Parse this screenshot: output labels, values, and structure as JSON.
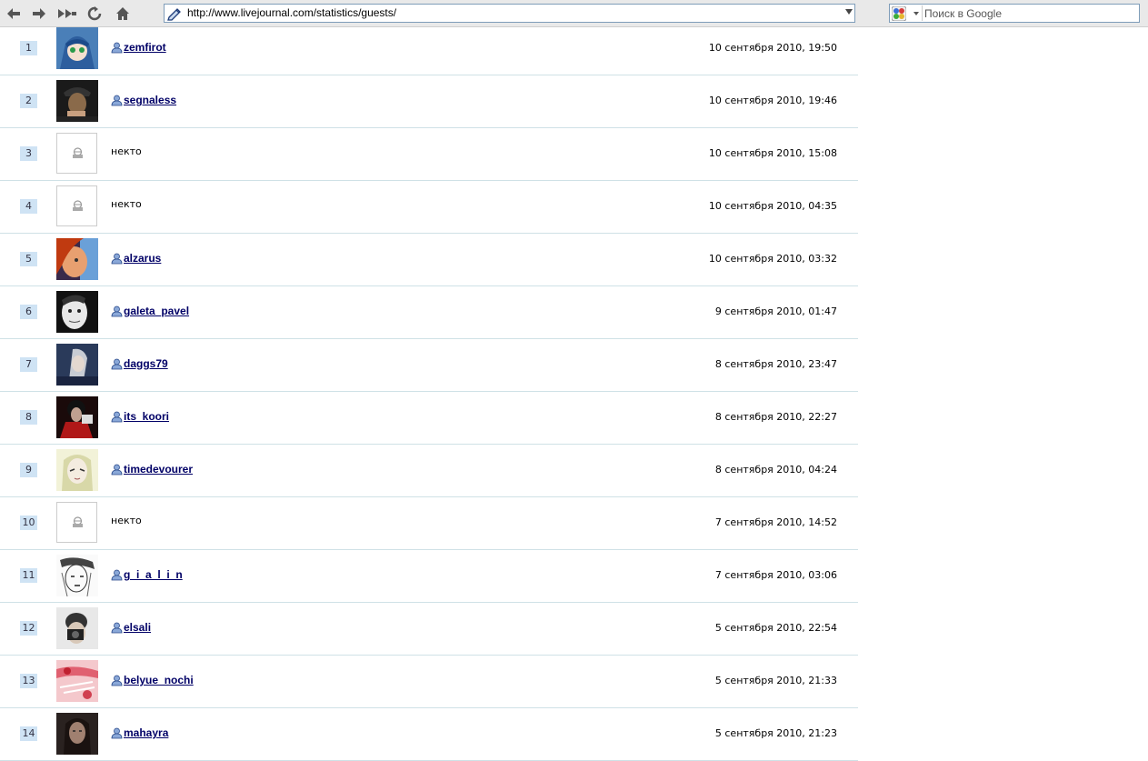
{
  "browser": {
    "url": "http://www.livejournal.com/statistics/guests/",
    "search_placeholder": "Поиск в Google",
    "nav_icons": [
      "back-icon",
      "forward-icon",
      "fast-forward-icon",
      "reload-icon",
      "home-icon"
    ]
  },
  "anon_label": "некто",
  "guests": [
    {
      "num": "1",
      "user": "zemfirot",
      "date": "10 сентября 2010, 19:50",
      "pic": "blue-anime"
    },
    {
      "num": "2",
      "user": "segnaless",
      "date": "10 сентября 2010, 19:46",
      "pic": "dark-portrait"
    },
    {
      "num": "3",
      "user": "",
      "date": "10 сентября 2010, 15:08",
      "pic": "none"
    },
    {
      "num": "4",
      "user": "",
      "date": "10 сентября 2010, 04:35",
      "pic": "none"
    },
    {
      "num": "5",
      "user": "alzarus",
      "date": "10 сентября 2010, 03:32",
      "pic": "red-face"
    },
    {
      "num": "6",
      "user": "galeta_pavel",
      "date": "9 сентября 2010, 01:47",
      "pic": "bw-face"
    },
    {
      "num": "7",
      "user": "daggs79",
      "date": "8 сентября 2010, 23:47",
      "pic": "blue-figure"
    },
    {
      "num": "8",
      "user": "its_koori",
      "date": "8 сентября 2010, 22:27",
      "pic": "red-figure"
    },
    {
      "num": "9",
      "user": "timedevourer",
      "date": "8 сентября 2010, 04:24",
      "pic": "anime-girl"
    },
    {
      "num": "10",
      "user": "",
      "date": "7 сентября 2010, 14:52",
      "pic": "none"
    },
    {
      "num": "11",
      "user": "g_i_a_l_i_n",
      "date": "7 сентября 2010, 03:06",
      "pic": "sketch"
    },
    {
      "num": "12",
      "user": "elsali",
      "date": "5 сентября 2010, 22:54",
      "pic": "camera"
    },
    {
      "num": "13",
      "user": "belyue_nochi",
      "date": "5 сентября 2010, 21:33",
      "pic": "pink"
    },
    {
      "num": "14",
      "user": "mahayra",
      "date": "5 сентября 2010, 21:23",
      "pic": "dark-girl"
    }
  ],
  "colors": {
    "link": "#000066",
    "num_bg": "#cfe3f4",
    "divider": "#cfe1e6"
  }
}
